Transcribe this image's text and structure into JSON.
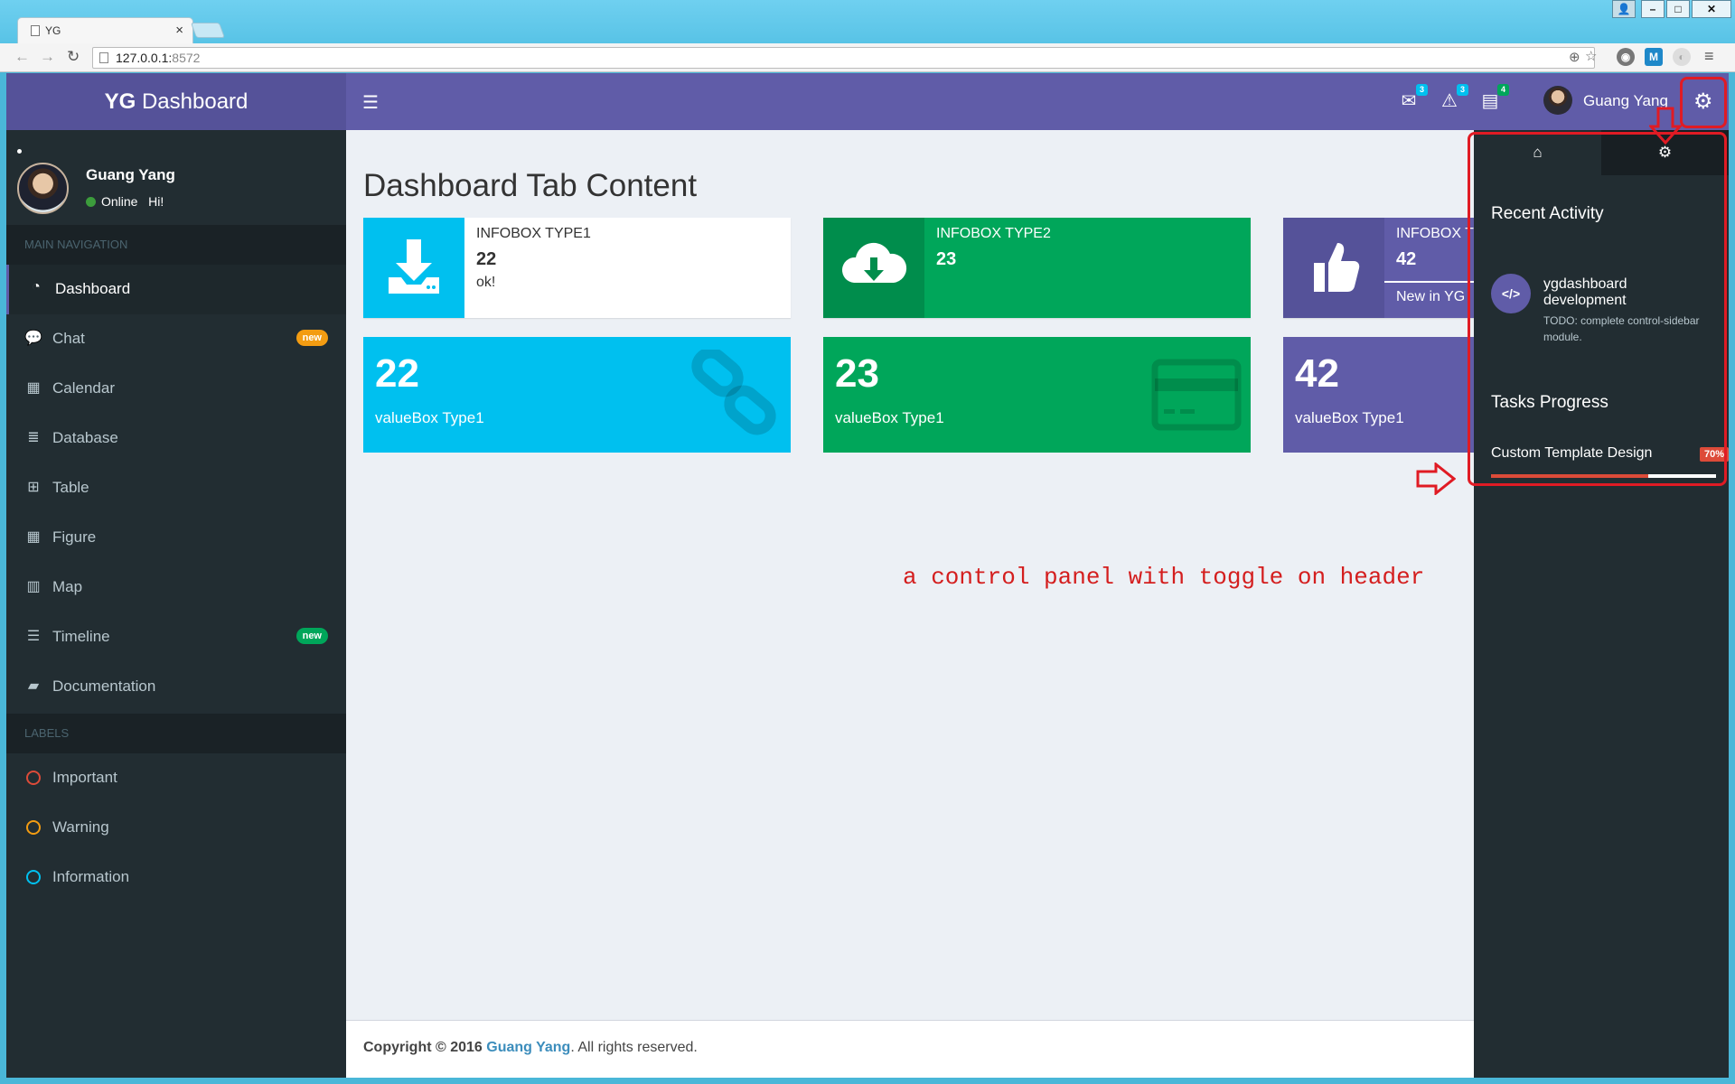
{
  "browser": {
    "tab_title": "YG",
    "url_host": "127.0.0.1:",
    "url_port": "8572",
    "extension_letter": "M"
  },
  "app": {
    "logo_bold": "YG",
    "logo_rest": " Dashboard"
  },
  "navbar": {
    "messages_count": "3",
    "notifications_count": "3",
    "tasks_count": "4",
    "user_name": "Guang Yang"
  },
  "sidebar": {
    "user_name": "Guang Yang",
    "user_status": "Online",
    "user_greeting": "Hi!",
    "main_header": "MAIN NAVIGATION",
    "labels_header": "LABELS",
    "items": [
      {
        "label": "Dashboard",
        "icon": "dashboard-icon"
      },
      {
        "label": "Chat",
        "icon": "chat-icon",
        "badge": "new",
        "badge_color": "#f39c12"
      },
      {
        "label": "Calendar",
        "icon": "calendar-icon"
      },
      {
        "label": "Database",
        "icon": "database-icon"
      },
      {
        "label": "Table",
        "icon": "table-icon"
      },
      {
        "label": "Figure",
        "icon": "grid-icon"
      },
      {
        "label": "Map",
        "icon": "map-icon"
      },
      {
        "label": "Timeline",
        "icon": "list-icon",
        "badge": "new",
        "badge_color": "#00a65a"
      },
      {
        "label": "Documentation",
        "icon": "book-icon"
      }
    ],
    "labels": [
      {
        "label": "Important",
        "color": "#dd4b39"
      },
      {
        "label": "Warning",
        "color": "#f39c12"
      },
      {
        "label": "Information",
        "color": "#00c0ef"
      }
    ]
  },
  "main": {
    "title": "Dashboard Tab Content",
    "infoboxes": [
      {
        "text": "INFOBOX TYPE1",
        "number": "22",
        "sub": "ok!",
        "icon": "download-icon",
        "color": "#00c0ef"
      },
      {
        "text": "INFOBOX TYPE2",
        "number": "23",
        "icon": "cloud-download-icon",
        "color": "#00a65a"
      },
      {
        "text": "INFOBOX T",
        "number": "42",
        "sub": "New in YG",
        "icon": "thumbs-up-icon",
        "color": "#605ca8"
      }
    ],
    "valueboxes": [
      {
        "number": "22",
        "label": "valueBox Type1",
        "icon": "link-icon",
        "color": "#00c0ef"
      },
      {
        "number": "23",
        "label": "valueBox Type1",
        "icon": "credit-card-icon",
        "color": "#00a65a"
      },
      {
        "number": "42",
        "label": "valueBox Type1",
        "color": "#605ca8"
      }
    ],
    "annotation": "a control panel with toggle on header"
  },
  "footer": {
    "prefix": "Copyright © 2016 ",
    "author": "Guang Yang",
    "suffix": ". All rights reserved."
  },
  "control_sidebar": {
    "recent_heading": "Recent Activity",
    "activity_title": "ygdashboard development",
    "activity_desc": "TODO: complete control-sidebar module.",
    "tasks_heading": "Tasks Progress",
    "task_name": "Custom Template Design",
    "task_percent": "70%",
    "task_progress": 0.7
  },
  "colors": {
    "logo_bg": "#555299",
    "navbar_bg": "#605ca8",
    "sidebar_bg": "#222d32",
    "content_bg": "#ecf0f5",
    "annotation_red": "#e01b24"
  }
}
